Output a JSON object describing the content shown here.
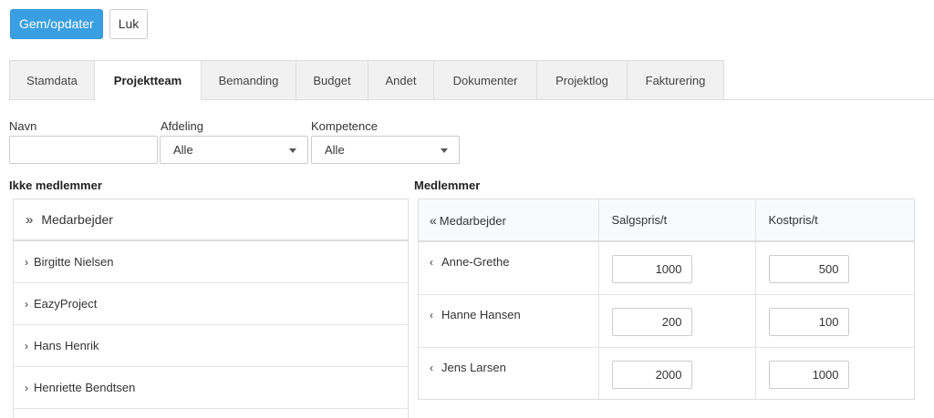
{
  "toolbar": {
    "save_label": "Gem/opdater",
    "close_label": "Luk"
  },
  "tabs": [
    {
      "label": "Stamdata",
      "active": false
    },
    {
      "label": "Projektteam",
      "active": true
    },
    {
      "label": "Bemanding",
      "active": false
    },
    {
      "label": "Budget",
      "active": false
    },
    {
      "label": "Andet",
      "active": false
    },
    {
      "label": "Dokumenter",
      "active": false
    },
    {
      "label": "Projektlog",
      "active": false
    },
    {
      "label": "Fakturering",
      "active": false
    }
  ],
  "filters": {
    "name_label": "Navn",
    "name_value": "",
    "department_label": "Afdeling",
    "department_value": "Alle",
    "competence_label": "Kompetence",
    "competence_value": "Alle"
  },
  "non_members": {
    "title": "Ikke medlemmer",
    "header_icon": "»",
    "header_label": "Medarbejder",
    "row_icon": "›",
    "items": [
      "Birgitte Nielsen",
      "EazyProject",
      "Hans Henrik",
      "Henriette Bendtsen"
    ]
  },
  "members": {
    "title": "Medlemmer",
    "header_icon": "«",
    "row_icon": "‹",
    "columns": [
      "Medarbejder",
      "Salgspris/t",
      "Kostpris/t"
    ],
    "rows": [
      {
        "name": "Anne-Grethe",
        "sales_price": "1000",
        "cost_price": "500"
      },
      {
        "name": "Hanne Hansen",
        "sales_price": "200",
        "cost_price": "100"
      },
      {
        "name": "Jens Larsen",
        "sales_price": "2000",
        "cost_price": "1000"
      }
    ]
  },
  "colors": {
    "primary": "#3a9fe2",
    "border": "#dddddd",
    "tab_bg": "#f1f1f1"
  }
}
